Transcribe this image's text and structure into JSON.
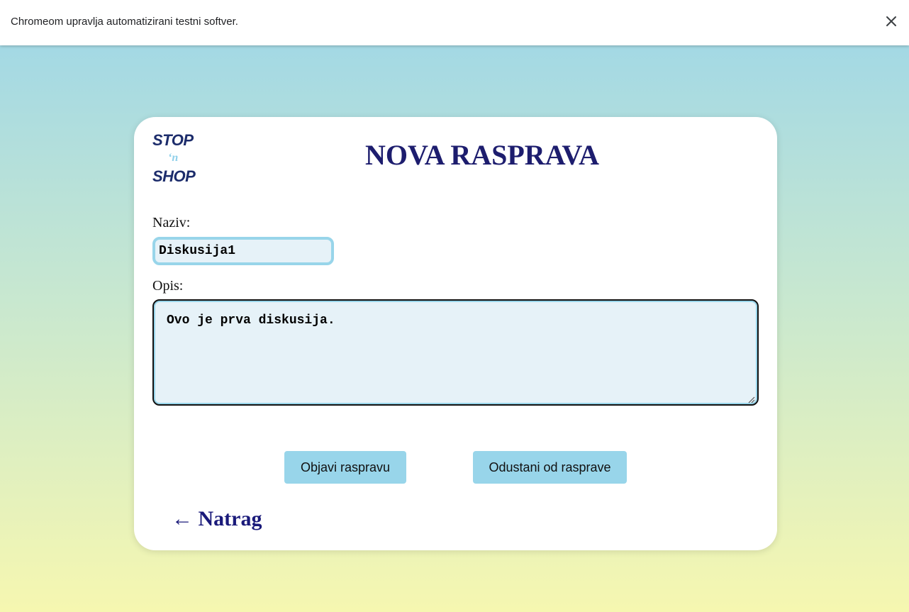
{
  "infobar": {
    "message": "Chromeom upravlja automatizirani testni softver.",
    "close_icon": "close-icon"
  },
  "logo": {
    "line1": "STOP",
    "line2": "‘n",
    "line3": "SHOP"
  },
  "page": {
    "title": "NOVA RASPRAVA"
  },
  "form": {
    "naziv_label": "Naziv:",
    "naziv_value": "Diskusija1",
    "opis_label": "Opis:",
    "opis_value": "Ovo je prva diskusija."
  },
  "buttons": {
    "publish_label": "Objavi raspravu",
    "cancel_label": "Odustani od rasprave"
  },
  "nav": {
    "back_label": "← Natrag"
  },
  "colors": {
    "accent": "#98d5ea",
    "title": "#1d1d6e",
    "field_bg": "#e6f2f8",
    "logo": "#1c2c6b"
  }
}
